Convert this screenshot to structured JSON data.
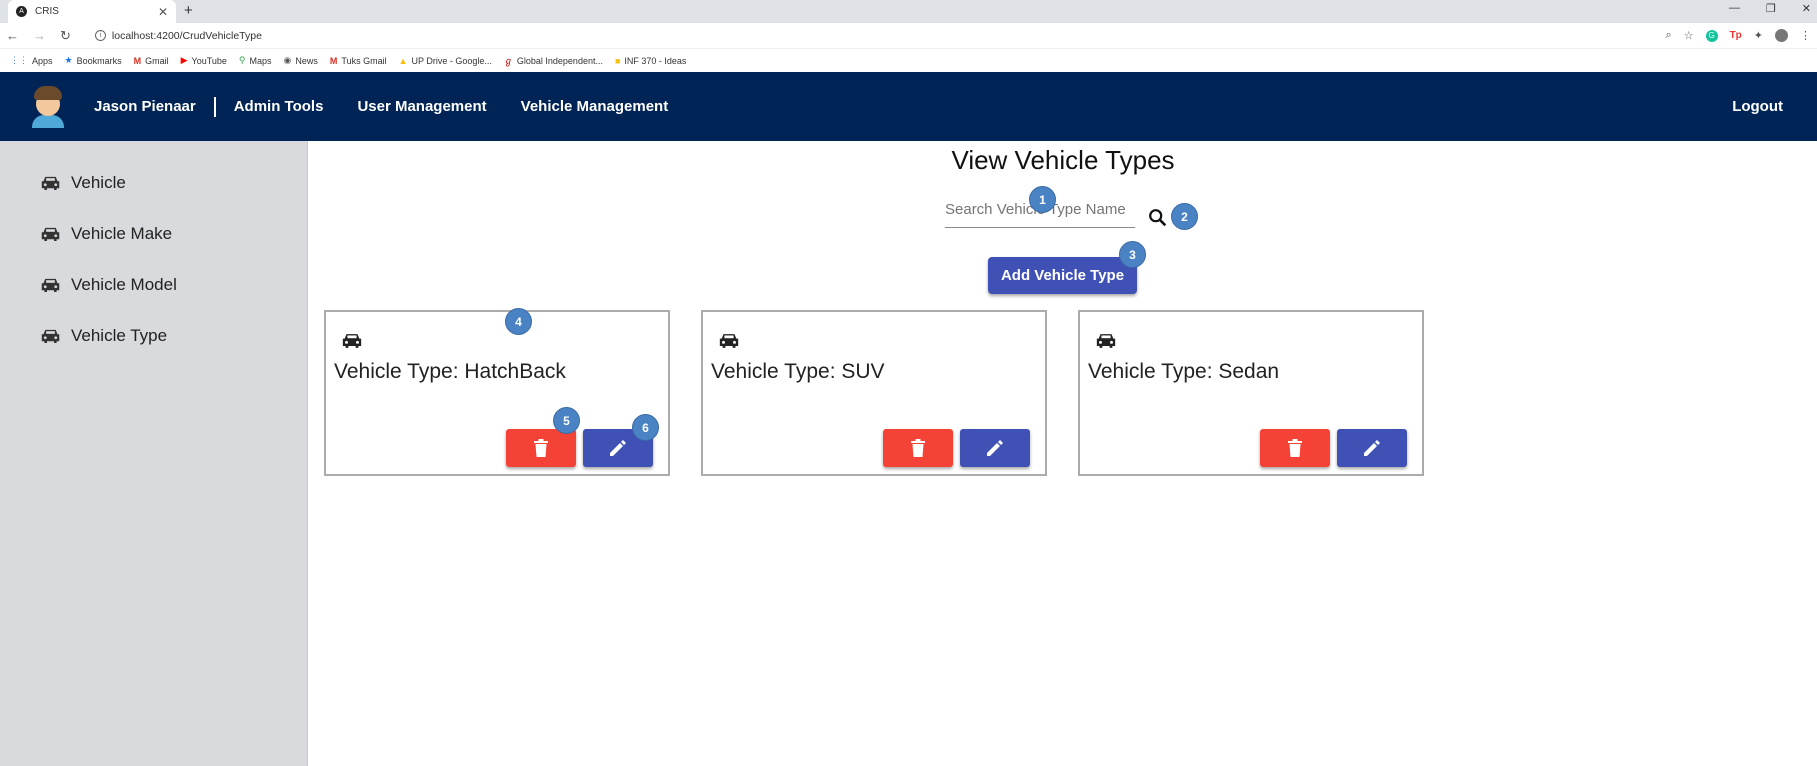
{
  "browser": {
    "tab_title": "CRIS",
    "tab_favicon": "A",
    "url": "localhost:4200/CrudVehicleType",
    "bookmarks": [
      {
        "label": "Apps",
        "icon": "apps-grid-icon"
      },
      {
        "label": "Bookmarks",
        "icon": "star-icon"
      },
      {
        "label": "Gmail",
        "icon": "gmail-icon"
      },
      {
        "label": "YouTube",
        "icon": "youtube-icon"
      },
      {
        "label": "Maps",
        "icon": "maps-pin-icon"
      },
      {
        "label": "News",
        "icon": "globe-icon"
      },
      {
        "label": "Tuks Gmail",
        "icon": "gmail-icon"
      },
      {
        "label": "UP Drive - Google...",
        "icon": "drive-icon"
      },
      {
        "label": "Global Independent...",
        "icon": "site-icon"
      },
      {
        "label": "INF 370 - Ideas",
        "icon": "folder-icon"
      }
    ],
    "ext_tp_label": "Tp"
  },
  "navbar": {
    "user_name": "Jason Pienaar",
    "links": [
      "Admin Tools",
      "User Management",
      "Vehicle Management"
    ],
    "logout": "Logout",
    "bg_color": "#002455"
  },
  "sidebar": {
    "items": [
      {
        "label": "Vehicle",
        "icon": "car-icon"
      },
      {
        "label": "Vehicle Make",
        "icon": "car-icon"
      },
      {
        "label": "Vehicle Model",
        "icon": "car-icon"
      },
      {
        "label": "Vehicle Type",
        "icon": "car-icon"
      }
    ]
  },
  "main": {
    "title": "View Vehicle Types",
    "search_placeholder": "Search Vehicle Type Name",
    "add_button": "Add Vehicle Type",
    "cards": [
      {
        "title": "Vehicle Type: HatchBack"
      },
      {
        "title": "Vehicle Type: SUV"
      },
      {
        "title": "Vehicle Type: Sedan"
      }
    ],
    "delete_color": "#f44336",
    "primary_color": "#3f51b5"
  },
  "callouts": [
    "1",
    "2",
    "3",
    "4",
    "5",
    "6"
  ]
}
